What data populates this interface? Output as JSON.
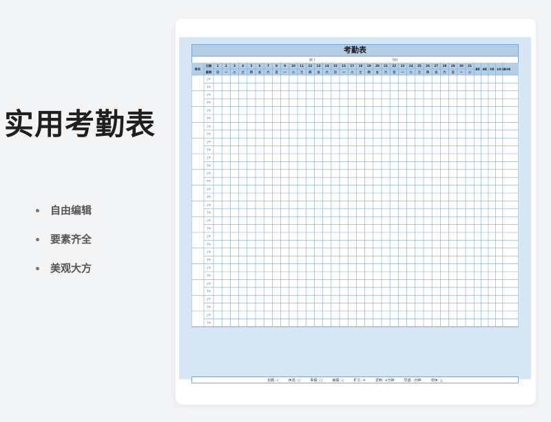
{
  "hero": {
    "title": "实用考勤表"
  },
  "features": [
    "自由编辑",
    "要素齐全",
    "美观大方"
  ],
  "sheet": {
    "title": "考勤表",
    "dept_label": "部门:",
    "month_label": "月份:",
    "name_header": "姓名",
    "date_label": "日期",
    "week_label": "星期",
    "days": [
      "1",
      "2",
      "3",
      "4",
      "5",
      "6",
      "7",
      "8",
      "9",
      "10",
      "11",
      "12",
      "13",
      "14",
      "15",
      "16",
      "17",
      "18",
      "19",
      "20",
      "21",
      "22",
      "23",
      "24",
      "25",
      "26",
      "27",
      "28",
      "29",
      "30",
      "31"
    ],
    "weekdays": [
      "日",
      "一",
      "二",
      "三",
      "四",
      "五",
      "六",
      "日",
      "一",
      "二",
      "三",
      "四",
      "五",
      "六",
      "日",
      "一",
      "二",
      "三",
      "四",
      "五",
      "六",
      "日",
      "一",
      "二",
      "三",
      "四",
      "五",
      "六",
      "日",
      "一",
      "二"
    ],
    "summary_headers": [
      "事假",
      "病假",
      "年假",
      "迟到",
      "出勤天数"
    ],
    "periods": [
      "上午",
      "下午"
    ],
    "employee_rows": 16,
    "legend": [
      "出勤: √",
      "休息: ○",
      "事假: □",
      "病假: ◇",
      "旷工: ×",
      "迟到: +分钟",
      "早退: -分钟",
      "年休: △"
    ]
  },
  "colors": {
    "header_fill": "#b3cfe8",
    "grid_line": "#7da5cc",
    "frame": "#d7e6f5"
  }
}
